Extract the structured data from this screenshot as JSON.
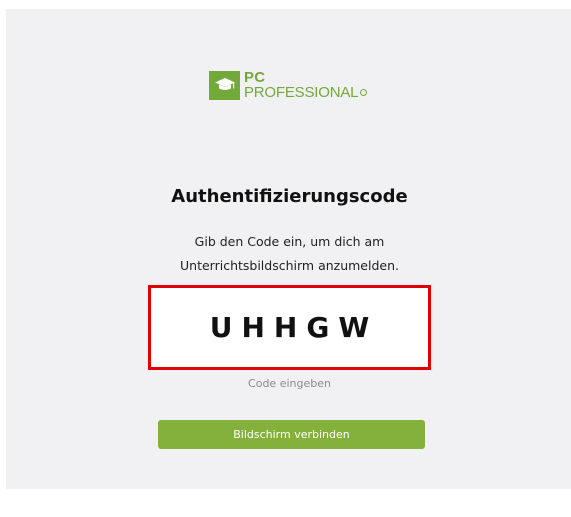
{
  "logo": {
    "line1": "PC",
    "line2": "PROFESSIONAL",
    "icon": "graduation-cap-icon",
    "brand_color": "#73a93a"
  },
  "auth": {
    "title": "Authentifizierungscode",
    "subtitle_line1": "Gib den Code ein, um dich am",
    "subtitle_line2": "Unterrichtsbildschirm anzumelden.",
    "code_value": "UHHGW",
    "code_hint": "Code eingeben",
    "connect_button_label": "Bildschirm verbinden"
  },
  "colors": {
    "background": "#f1f1f3",
    "highlight_border": "#e00000",
    "button": "#84b13c"
  }
}
